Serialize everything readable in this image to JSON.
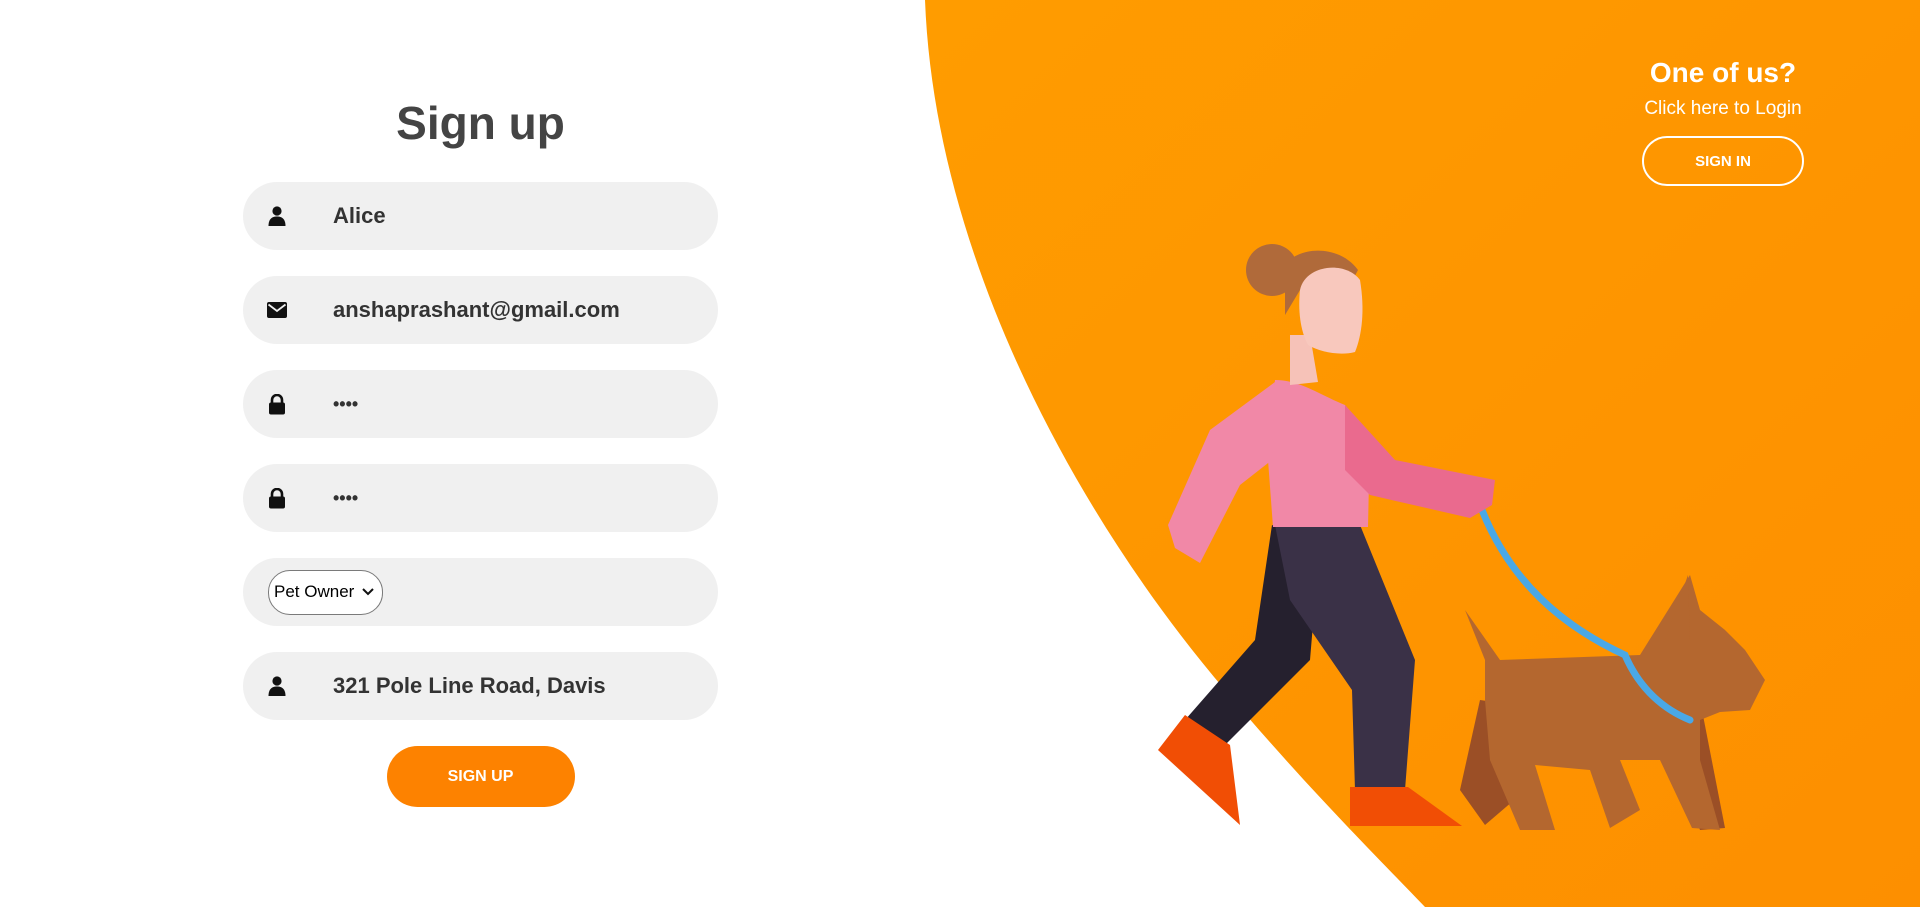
{
  "form": {
    "title": "Sign up",
    "fields": [
      {
        "type": "text",
        "icon": "user-icon",
        "value": "Alice"
      },
      {
        "type": "email",
        "icon": "envelope-icon",
        "value": "anshaprashant@gmail.com"
      },
      {
        "type": "password",
        "icon": "lock-icon",
        "value": "••••"
      },
      {
        "type": "password",
        "icon": "lock-icon",
        "value": "••••"
      },
      {
        "type": "select",
        "selected": "Pet Owner"
      },
      {
        "type": "text",
        "icon": "user-icon",
        "value": "321 Pole Line Road, Davis"
      }
    ],
    "submit_label": "SIGN UP"
  },
  "login_panel": {
    "heading": "One of us?",
    "subtext": "Click here to Login",
    "button_label": "SIGN IN"
  },
  "colors": {
    "accent_orange": "#ff9a00",
    "button_orange": "#fd8200",
    "field_bg": "#f0f0f0"
  },
  "illustration": "woman-walking-dog-illustration"
}
